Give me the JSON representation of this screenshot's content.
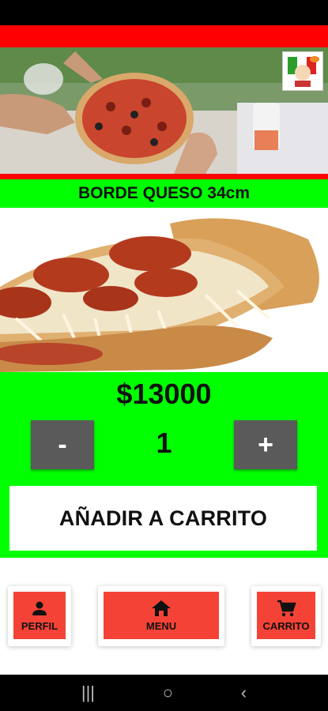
{
  "header": {
    "logo_icon": "pizzeria-logo-icon"
  },
  "product": {
    "title": "BORDE QUESO 34cm",
    "price": "$13000",
    "image_icon": "pepperoni-pizza-image"
  },
  "quantity": {
    "minus_label": "-",
    "value": "1",
    "plus_label": "+"
  },
  "actions": {
    "add_to_cart_label": "AÑADIR A CARRITO"
  },
  "bottom_nav": {
    "items": [
      {
        "label": "PERFIL",
        "icon": "person-icon"
      },
      {
        "label": "MENU",
        "icon": "home-icon"
      },
      {
        "label": "CARRITO",
        "icon": "cart-icon"
      }
    ]
  },
  "system_nav": {
    "recents": "|||",
    "home": "○",
    "back": "‹"
  },
  "colors": {
    "green": "#00ff00",
    "red": "#ff0000",
    "nav_button": "#f44336",
    "qty_button": "#5a5a5a"
  }
}
